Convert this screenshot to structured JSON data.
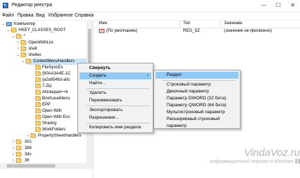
{
  "window": {
    "title": "Редактор реестра",
    "min_glyph": "—",
    "max_glyph": "☐",
    "close_glyph": "✕"
  },
  "menu": [
    "Файл",
    "Правка",
    "Вид",
    "Избранное",
    "Справка"
  ],
  "tree": {
    "expand_glyph": "⌄",
    "collapse_glyph": "›",
    "items": [
      {
        "label": "Компьютер",
        "expander": "⌄",
        "icon": "computer-icon"
      },
      {
        "label": "HKEY_CLASSES_ROOT",
        "expander": "⌄",
        "icon": "folder-icon"
      },
      {
        "label": "*",
        "expander": "⌄",
        "icon": "folder-icon"
      },
      {
        "label": "OpenWithList",
        "expander": "›",
        "icon": "folder-icon"
      },
      {
        "label": "shell",
        "expander": "›",
        "icon": "folder-icon"
      },
      {
        "label": "shellex",
        "expander": "⌄",
        "icon": "folder-icon"
      },
      {
        "label": "ContextMenuHandlers",
        "expander": "⌄",
        "icon": "folder-icon",
        "selected": true
      },
      {
        "label": "FileSyncEx",
        "expander": "",
        "icon": "folder-icon"
      },
      {
        "label": "{90AA3A4E-1C",
        "expander": "",
        "icon": "folder-icon"
      },
      {
        "label": "{a2a9545d-a0c",
        "expander": "",
        "icon": "folder-icon"
      },
      {
        "label": "7-Zip",
        "expander": "",
        "icon": "folder-icon"
      },
      {
        "label": "ANotepad++6",
        "expander": "",
        "icon": "folder-icon"
      },
      {
        "label": "BriefcaseMenu",
        "expander": "",
        "icon": "folder-icon"
      },
      {
        "label": "EPP",
        "expander": "",
        "icon": "folder-icon"
      },
      {
        "label": "Open With",
        "expander": "",
        "icon": "folder-icon"
      },
      {
        "label": "Open With Enc",
        "expander": "",
        "icon": "folder-icon"
      },
      {
        "label": "Sharing",
        "expander": "",
        "icon": "folder-icon"
      },
      {
        "label": "WorkFolders",
        "expander": "",
        "icon": "folder-icon"
      },
      {
        "label": "PropertySheetHandlers",
        "expander": "›",
        "icon": "folder-icon"
      },
      {
        "label": "",
        "expander": "",
        "icon": ""
      },
      {
        "label": ".001",
        "expander": "›",
        "icon": "folder-icon"
      },
      {
        "label": ".386",
        "expander": "›",
        "icon": "folder-icon"
      },
      {
        "label": ".3ds",
        "expander": "›",
        "icon": "folder-icon"
      },
      {
        "label": ".3fr",
        "expander": "›",
        "icon": "folder-icon"
      },
      {
        "label": ".3g2",
        "expander": "›",
        "icon": "folder-icon"
      }
    ]
  },
  "values_table": {
    "columns": [
      "Имя",
      "Тип",
      "Значение"
    ],
    "rows": [
      {
        "icon": "ab",
        "name": "(По умолчанию)",
        "type": "REG_SZ",
        "value": "(значение не присвоено)"
      }
    ]
  },
  "context_menu": {
    "items": [
      {
        "label": "Свернуть",
        "bold": true
      },
      {
        "label": "Создать",
        "submenu": true,
        "highlighted": true
      },
      {
        "label": "Найти..."
      },
      {
        "label": "Удалить"
      },
      {
        "label": "Переименовать"
      },
      {
        "label": "Экспортировать"
      },
      {
        "label": "Разрешения..."
      },
      {
        "label": "Копировать имя раздела"
      }
    ],
    "arrow_glyph": "›"
  },
  "submenu": {
    "items": [
      {
        "label": "Раздел",
        "highlighted": true
      },
      {
        "label": "Строковый параметр"
      },
      {
        "label": "Двоичный параметр"
      },
      {
        "label": "Параметр DWORD (32 бита)"
      },
      {
        "label": "Параметр QWORD (64 бита)"
      },
      {
        "label": "Мультистроковый параметр"
      },
      {
        "label": "Расширяемый строковый параметр"
      }
    ]
  },
  "watermark": {
    "site": "VindaVoz.ru",
    "tagline": "информационный портал о Windows"
  },
  "colors": {
    "selection": "#cce4f7",
    "menu_highlight": "#91c9f7",
    "folder": "#f7d27a"
  }
}
